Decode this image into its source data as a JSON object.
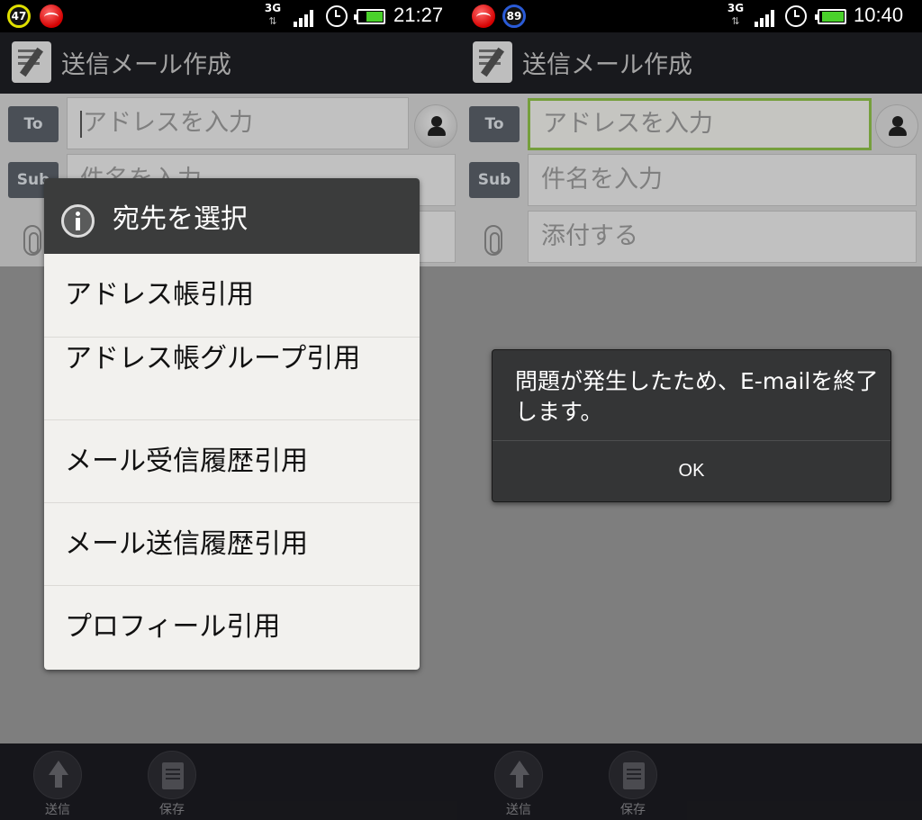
{
  "left": {
    "status_bar": {
      "battery_percent": "47",
      "time": "21:27",
      "network": "3G"
    },
    "title": "送信メール作成",
    "to_label": "To",
    "to_placeholder": "アドレスを入力",
    "subject_label": "Sub",
    "subject_placeholder": "件名を入力",
    "dialog": {
      "title": "宛先を選択",
      "items": [
        "アドレス帳引用",
        "アドレス帳グループ引用",
        "メール受信履歴引用",
        "メール送信履歴引用",
        "プロフィール引用"
      ]
    },
    "bottom": {
      "send_label": "送信",
      "save_label": "保存"
    }
  },
  "right": {
    "status_bar": {
      "notification_count": "89",
      "time": "10:40",
      "network": "3G"
    },
    "title": "送信メール作成",
    "to_label": "To",
    "to_placeholder": "アドレスを入力",
    "subject_label": "Sub",
    "subject_placeholder": "件名を入力",
    "attach_placeholder": "添付する",
    "alert": {
      "message": "問題が発生したため、E-mailを終了します。",
      "ok_label": "OK"
    },
    "bottom": {
      "send_label": "送信",
      "save_label": "保存"
    }
  },
  "colors": {
    "accent_focus": "#8fc24a",
    "dialog_header": "#3b3c3c",
    "alert_bg": "#343536",
    "battery": "#4ad12b"
  }
}
